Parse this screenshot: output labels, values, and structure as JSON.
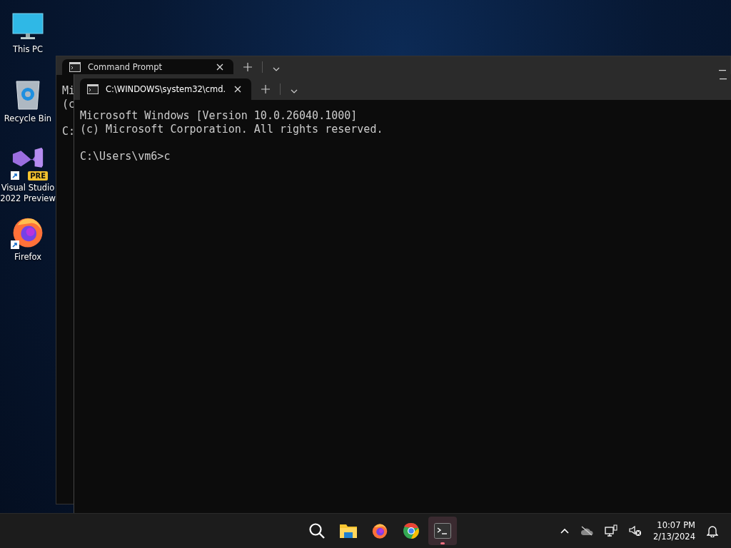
{
  "desktop_icons": [
    {
      "kind": "pc",
      "label": "This PC"
    },
    {
      "kind": "bin",
      "label": "Recycle Bin"
    },
    {
      "kind": "vs",
      "label": "Visual Studio 2022 Preview",
      "badge": "PRE",
      "shortcut": true
    },
    {
      "kind": "firefox",
      "label": "Firefox",
      "shortcut": true
    }
  ],
  "windows": [
    {
      "tab_title": "Command Prompt",
      "paragraphs": [
        [
          "Mi",
          "(c"
        ],
        [
          "C:"
        ]
      ]
    },
    {
      "tab_title": "C:\\WINDOWS\\system32\\cmd.",
      "paragraphs": [
        [
          "Microsoft Windows [Version 10.0.26040.1000]",
          "(c) Microsoft Corporation. All rights reserved."
        ],
        [
          "C:\\Users\\vm6>c"
        ]
      ]
    }
  ],
  "taskbar": {
    "apps": [
      {
        "kind": "search",
        "selected": false
      },
      {
        "kind": "files",
        "selected": false
      },
      {
        "kind": "firefox",
        "selected": false
      },
      {
        "kind": "chrome",
        "selected": false
      },
      {
        "kind": "terminal",
        "selected": true
      }
    ],
    "time": "10:07 PM",
    "date": "2/13/2024"
  }
}
